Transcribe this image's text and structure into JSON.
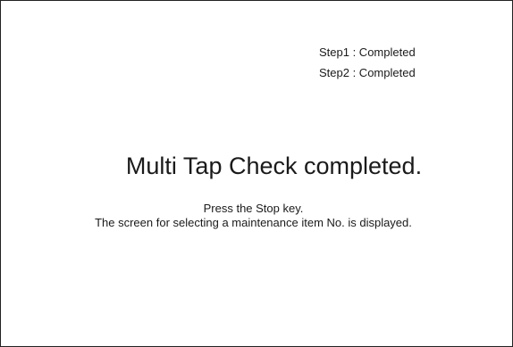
{
  "steps": [
    {
      "text": "Step1 : Completed"
    },
    {
      "text": "Step2 : Completed"
    }
  ],
  "message": {
    "headline": "Multi Tap Check completed.",
    "instruction_line1": "Press the Stop key.",
    "instruction_line2": "The screen for selecting a maintenance item No. is displayed."
  }
}
